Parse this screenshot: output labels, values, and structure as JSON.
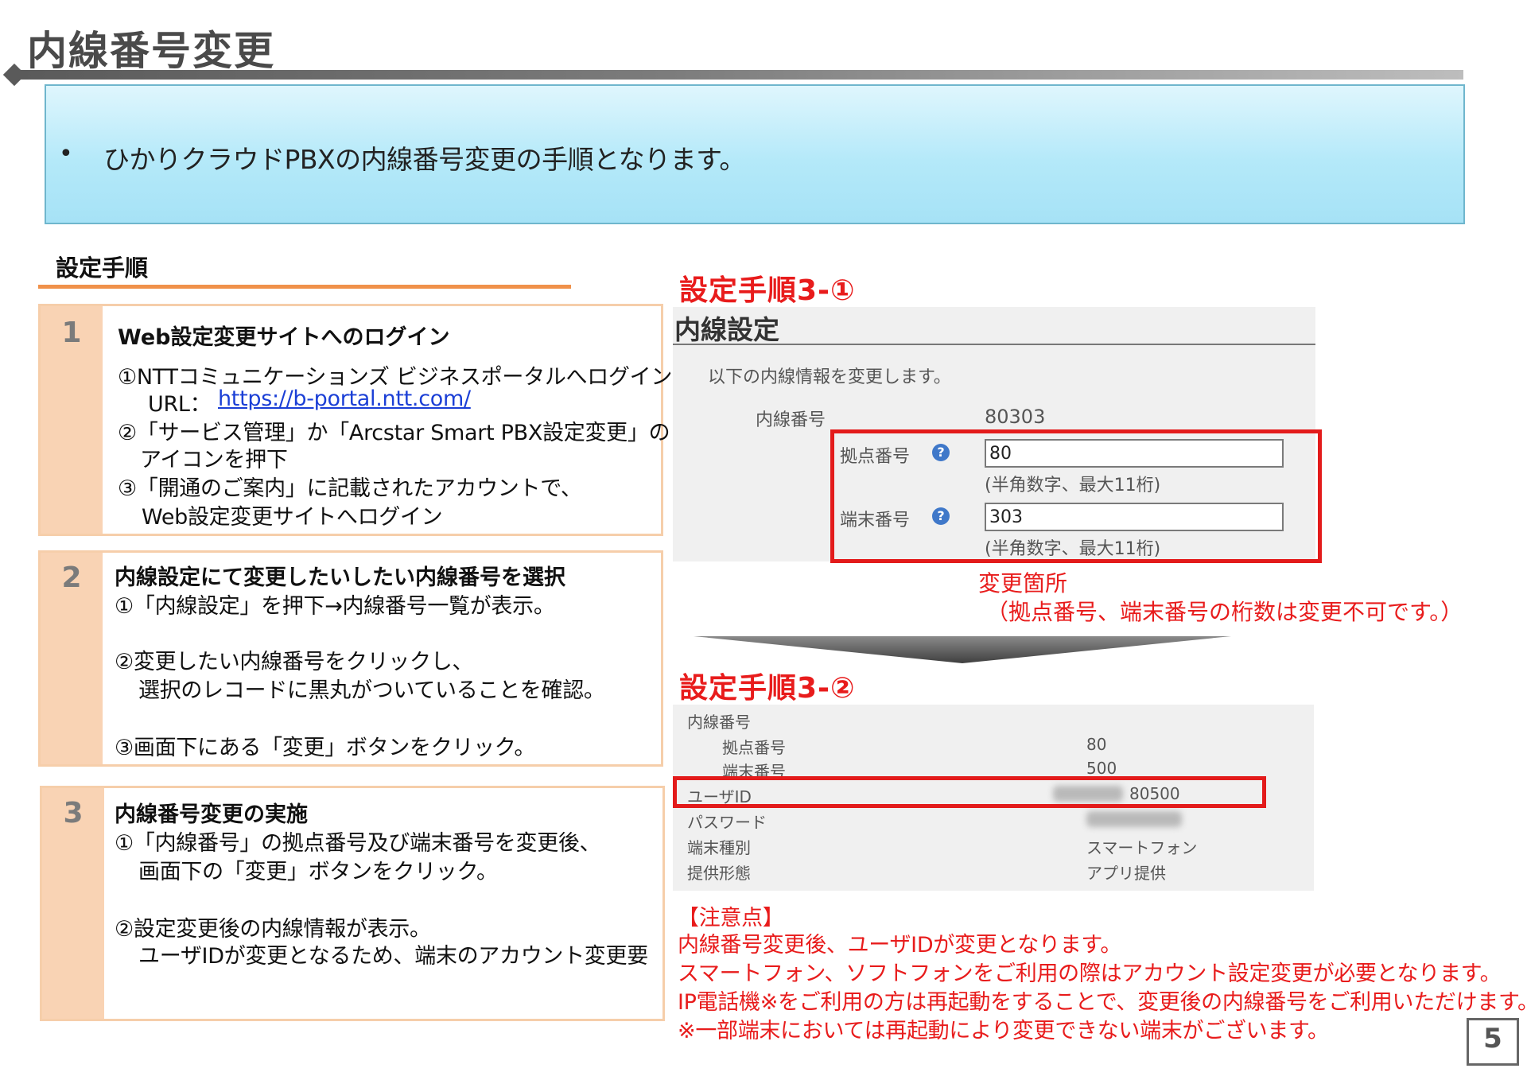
{
  "header": {
    "title": "内線番号変更"
  },
  "intro": {
    "bullet": "•",
    "text": "ひかりクラウドPBXの内線番号変更の手順となります。"
  },
  "procedure": {
    "heading": "設定手順",
    "steps": [
      {
        "number": "1",
        "title": "Web設定変更サイトへのログイン",
        "lines": [
          "①NTTコミュニケーションズ ビジネスポータルへログイン",
          "URL：",
          "https://b-portal.ntt.com/",
          "②「サービス管理」か「Arcstar Smart PBX設定変更」の",
          "アイコンを押下",
          "③「開通のご案内」に記載されたアカウントで、",
          "Web設定変更サイトへログイン"
        ]
      },
      {
        "number": "2",
        "title": "内線設定にて変更したいしたい内線番号を選択",
        "lines": [
          "①「内線設定」を押下→内線番号一覧が表示。",
          "②変更したい内線番号をクリックし、",
          "選択のレコードに黒丸がついていることを確認。",
          "③画面下にある「変更」ボタンをクリック。"
        ]
      },
      {
        "number": "3",
        "title": "内線番号変更の実施",
        "lines": [
          "①「内線番号」の拠点番号及び端末番号を変更後、",
          "画面下の「変更」ボタンをクリック。",
          "②設定変更後の内線情報が表示。",
          "ユーザIDが変更となるため、端末のアカウント変更要"
        ]
      }
    ]
  },
  "step3_1": {
    "heading": "設定手順3-①",
    "screen_title": "内線設定",
    "description": "以下の内線情報を変更します。",
    "ext_label": "内線番号",
    "ext_value": "80303",
    "site_label": "拠点番号",
    "site_value": "80",
    "site_hint": "(半角数字、最大11桁)",
    "term_label": "端末番号",
    "term_value": "303",
    "term_hint": "(半角数字、最大11桁)",
    "help_glyph": "?",
    "change_label": "変更箇所",
    "change_note": "（拠点番号、端末番号の桁数は変更不可です。）"
  },
  "step3_2": {
    "heading": "設定手順3-②",
    "rows": {
      "ext_label": "内線番号",
      "site_label": "拠点番号",
      "site_value": "80",
      "term_label": "端末番号",
      "term_value": "500",
      "userid_label": "ユーザID",
      "userid_value": "80500",
      "password_label": "パスワード",
      "type_label": "端末種別",
      "type_value": "スマートフォン",
      "provide_label": "提供形態",
      "provide_value": "アプリ提供"
    }
  },
  "notes": {
    "heading": "【注意点】",
    "lines": [
      "内線番号変更後、ユーザIDが変更となります。",
      "スマートフォン、ソフトフォンをご利用の際はアカウント設定変更が必要となります。",
      "IP電話機※をご利用の方は再起動をすることで、変更後の内線番号をご利用いただけます。",
      "※一部端末においては再起動により変更できない端末がございます。"
    ]
  },
  "footer": {
    "page_number": "5"
  },
  "colors": {
    "accent_red": "#e81c1c",
    "step_border": "#f6ceaa",
    "intro_bg": "#b4e9f9",
    "underline_orange": "#f0914a"
  }
}
